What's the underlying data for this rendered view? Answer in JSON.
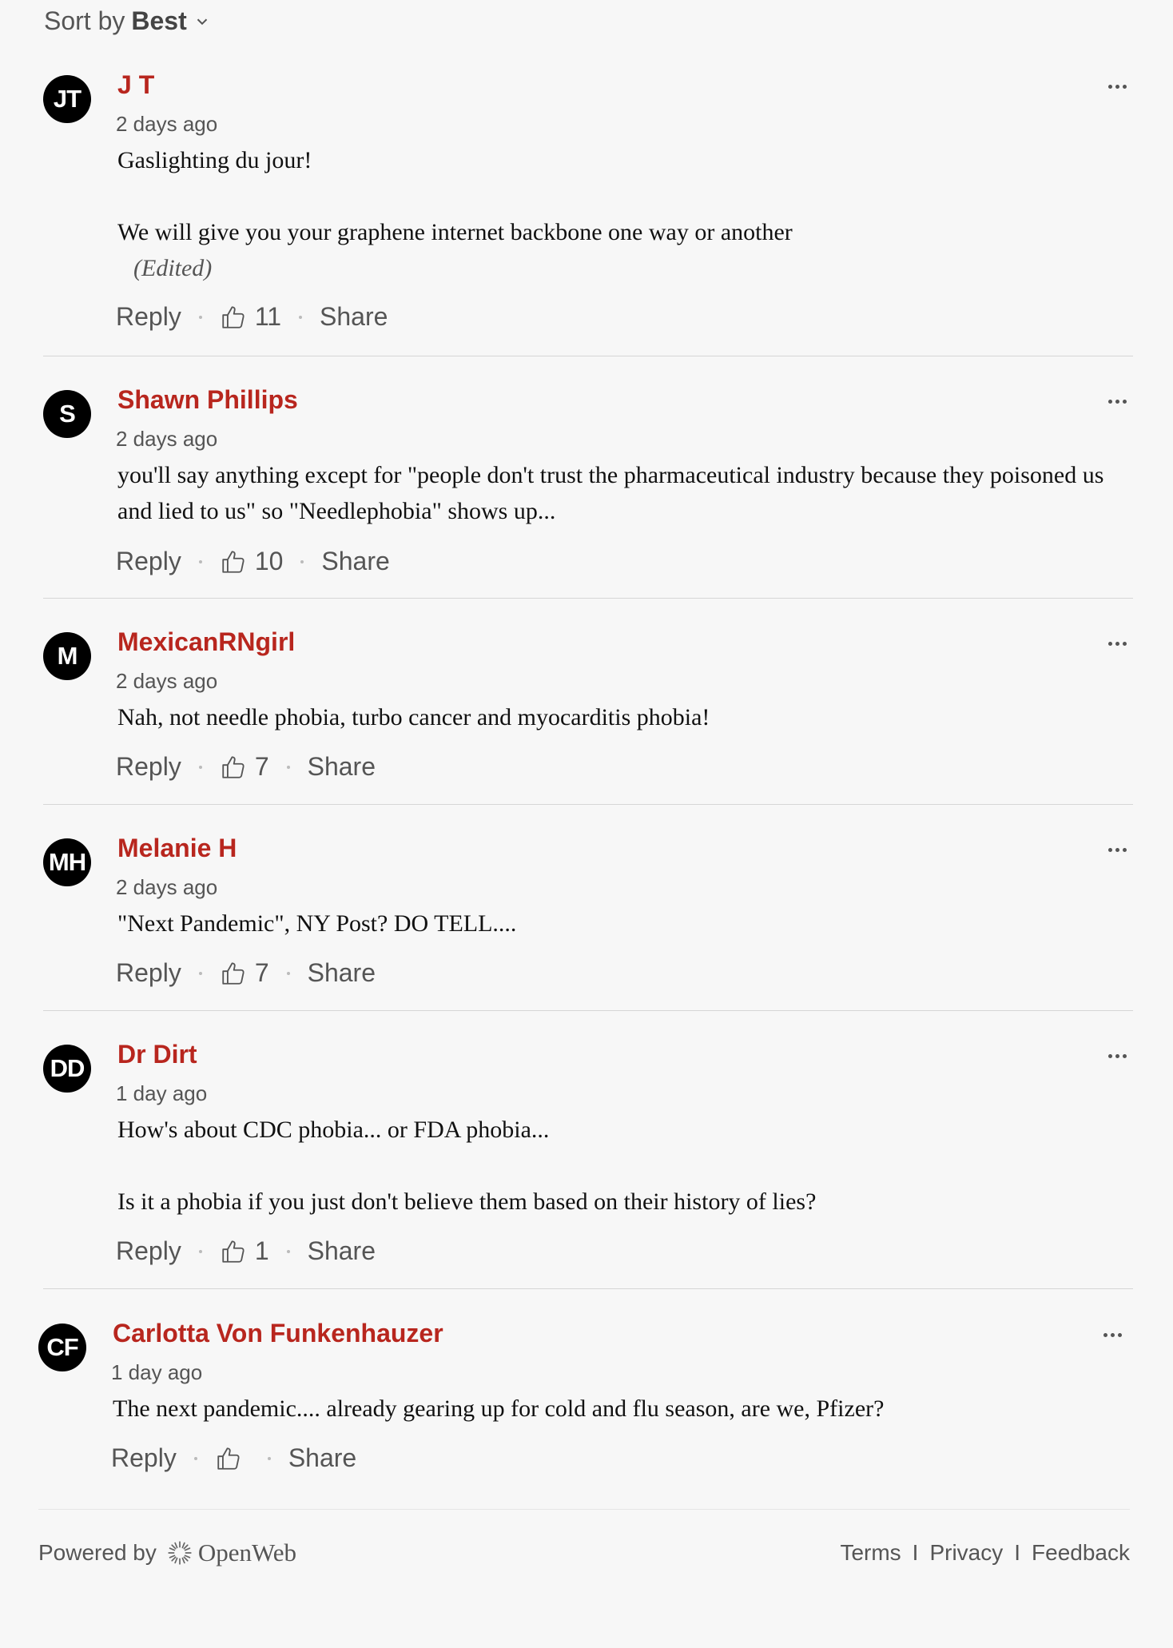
{
  "sort": {
    "prefix": "Sort by",
    "value": "Best"
  },
  "actions": {
    "reply_label": "Reply",
    "share_label": "Share"
  },
  "comments": [
    {
      "initials": "JT",
      "author": "J T",
      "time": "2 days ago",
      "paragraphs": [
        "Gaslighting du jour!",
        "We will give you your graphene internet backbone one way or another"
      ],
      "edited": "(Edited)",
      "likes": "11"
    },
    {
      "initials": "S",
      "author": "Shawn Phillips",
      "time": "2 days ago",
      "paragraphs": [
        "you'll say anything except for \"people don't trust the pharmaceutical industry because they poisoned us and lied to us\" so \"Needlephobia\" shows up..."
      ],
      "likes": "10"
    },
    {
      "initials": "M",
      "author": "MexicanRNgirl",
      "time": "2 days ago",
      "paragraphs": [
        "Nah, not needle phobia, turbo cancer and myocarditis phobia!"
      ],
      "likes": "7"
    },
    {
      "initials": "MH",
      "author": "Melanie H",
      "time": "2 days ago",
      "paragraphs": [
        "\"Next Pandemic\", NY Post? DO TELL...."
      ],
      "likes": "7"
    },
    {
      "initials": "DD",
      "author": "Dr Dirt",
      "time": "1 day ago",
      "paragraphs": [
        "How's about CDC phobia... or FDA phobia...",
        "Is it a phobia if you just don't believe them based on their history of lies?"
      ],
      "likes": "1"
    },
    {
      "initials": "CF",
      "author": "Carlotta Von Funkenhauzer",
      "time": "1 day ago",
      "paragraphs": [
        "The next pandemic.... already gearing up for cold and flu season, are we, Pfizer?"
      ],
      "likes": ""
    }
  ],
  "footer": {
    "powered_by": "Powered by",
    "brand": "OpenWeb",
    "links": [
      "Terms",
      "Privacy",
      "Feedback"
    ],
    "separator": "I"
  },
  "colors": {
    "author": "#b8261e",
    "background": "#f7f7f7",
    "avatar": "#000000"
  }
}
